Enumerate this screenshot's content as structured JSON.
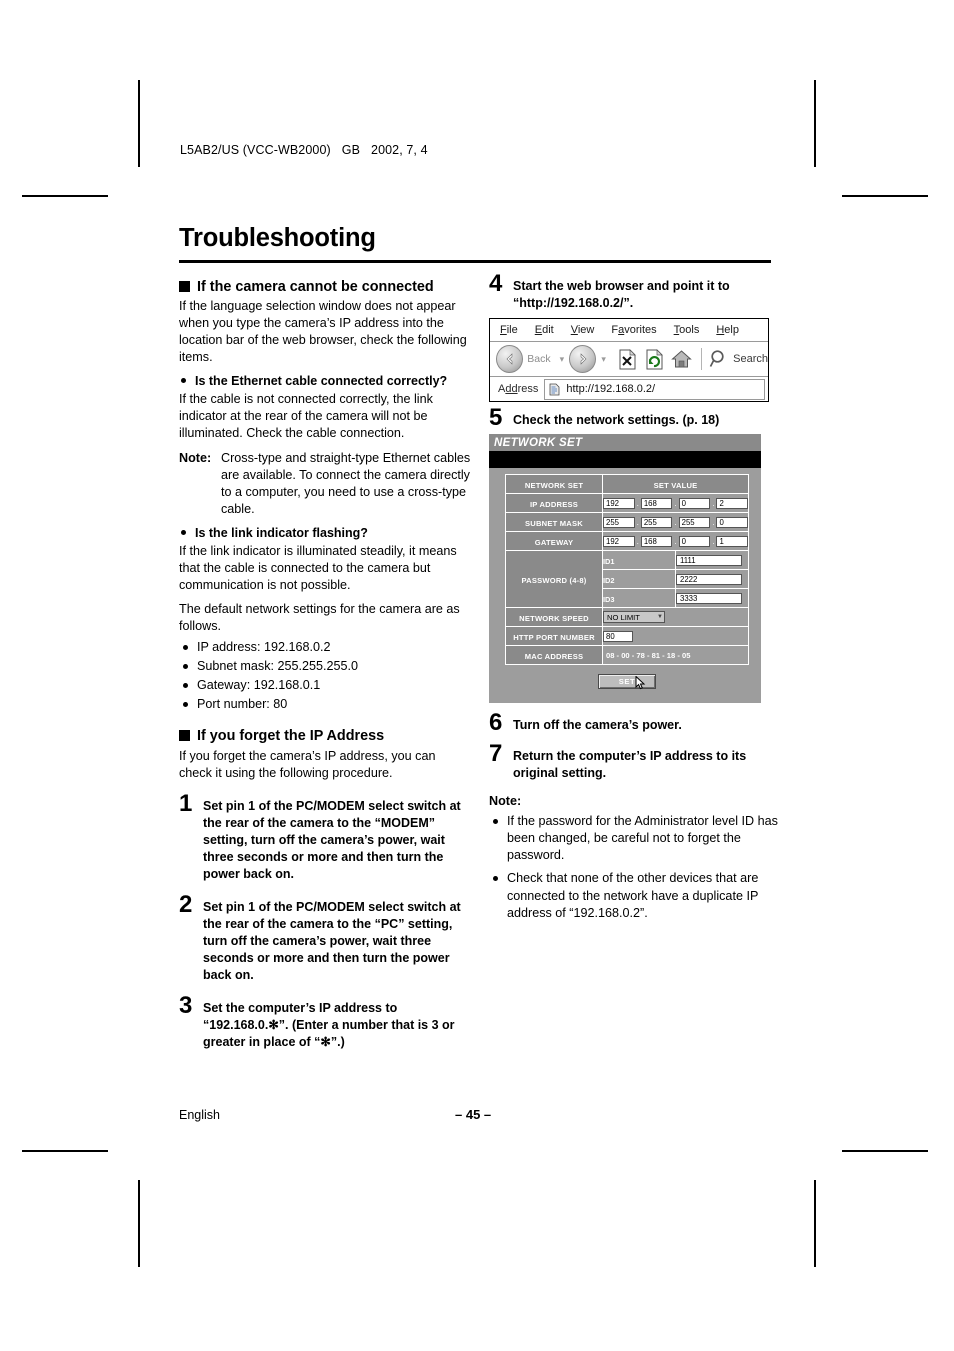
{
  "document": {
    "id_line": {
      "code": "L5AB2/US (VCC-WB2000)",
      "region": "GB",
      "date": "2002, 7, 4"
    },
    "title": "Troubleshooting",
    "footer_language": "English",
    "footer_page": "– 45 –"
  },
  "left_column": {
    "section1": {
      "heading": "If the camera cannot be connected",
      "intro": "If the language selection window does not appear when you type the camera’s IP address into the location bar of the web browser, check the following items.",
      "q1": {
        "heading": "Is the Ethernet cable connected correctly?",
        "body": "If the cable is not connected correctly, the link indicator at the rear of the camera will not be illuminated. Check the cable connection.",
        "note_label": "Note:",
        "note_body": "Cross-type and straight-type Ethernet cables are available. To connect the camera directly to a computer, you need to use a cross-type cable."
      },
      "q2": {
        "heading": "Is the link indicator flashing?",
        "body": "If the link indicator is illuminated steadily, it means that the cable is connected to the camera but communication is not possible.",
        "defaults_intro": "The default network settings for the camera are as follows.",
        "defaults": [
          "IP address: 192.168.0.2",
          "Subnet mask: 255.255.255.0",
          "Gateway: 192.168.0.1",
          "Port number: 80"
        ]
      }
    },
    "section2": {
      "heading": "If you forget the IP Address",
      "intro": "If you forget the camera’s IP address, you can check it using the following procedure.",
      "steps": [
        {
          "num": "1",
          "text": "Set pin 1 of the PC/MODEM select switch at the rear of the camera to the “MODEM” setting, turn off the camera’s power, wait three seconds or more and then turn the power back on."
        },
        {
          "num": "2",
          "text": "Set pin 1 of the PC/MODEM select switch at the rear of the camera to the “PC” setting, turn off the camera’s power, wait three seconds or more and then turn the power back on."
        },
        {
          "num": "3",
          "text": "Set the computer’s IP address to “192.168.0.✻”. (Enter a number that is 3 or greater in place of “✻”.)"
        }
      ]
    }
  },
  "right_column": {
    "step4": {
      "num": "4",
      "text": "Start the web browser and point it to “http://192.168.0.2/”."
    },
    "browser": {
      "menu": [
        "File",
        "Edit",
        "View",
        "Favorites",
        "Tools",
        "Help"
      ],
      "back_label": "Back",
      "search_label": "Search",
      "address_label": "Address",
      "address_value": "http://192.168.0.2/",
      "icons": [
        "back-icon",
        "forward-icon",
        "stop-icon",
        "refresh-icon",
        "home-icon",
        "search-icon",
        "page-icon"
      ]
    },
    "step5": {
      "num": "5",
      "text": "Check the network settings. (p. 18)"
    },
    "network_set": {
      "panel_title": "NETWORK SET",
      "col_header_left": "NETWORK SET",
      "col_header_right": "SET VALUE",
      "rows": [
        {
          "label": "IP ADDRESS",
          "octets": [
            "192",
            "168",
            "0",
            "2"
          ]
        },
        {
          "label": "SUBNET MASK",
          "octets": [
            "255",
            "255",
            "255",
            "0"
          ]
        },
        {
          "label": "GATEWAY",
          "octets": [
            "192",
            "168",
            "0",
            "1"
          ]
        }
      ],
      "password": {
        "label": "PASSWORD (4-8)",
        "entries": [
          {
            "id": "ID1",
            "value": "1111"
          },
          {
            "id": "ID2",
            "value": "2222"
          },
          {
            "id": "ID3",
            "value": "3333"
          }
        ]
      },
      "network_speed": {
        "label": "NETWORK SPEED",
        "value": "NO LIMIT"
      },
      "http_port": {
        "label": "HTTP PORT NUMBER",
        "value": "80"
      },
      "mac_address": {
        "label": "MAC ADDRESS",
        "value": "08 - 00 - 78 - 81 - 18 - 05"
      },
      "set_button": "SET"
    },
    "step6": {
      "num": "6",
      "text": "Turn off the camera’s power."
    },
    "step7": {
      "num": "7",
      "text": "Return the computer’s IP address to its original setting."
    },
    "note_header": "Note:",
    "notes": [
      "If the password for the Administrator level ID has been changed, be careful not to forget the password.",
      "Check that none of the other devices that are connected to the network have a duplicate IP address of “192.168.0.2”."
    ]
  }
}
